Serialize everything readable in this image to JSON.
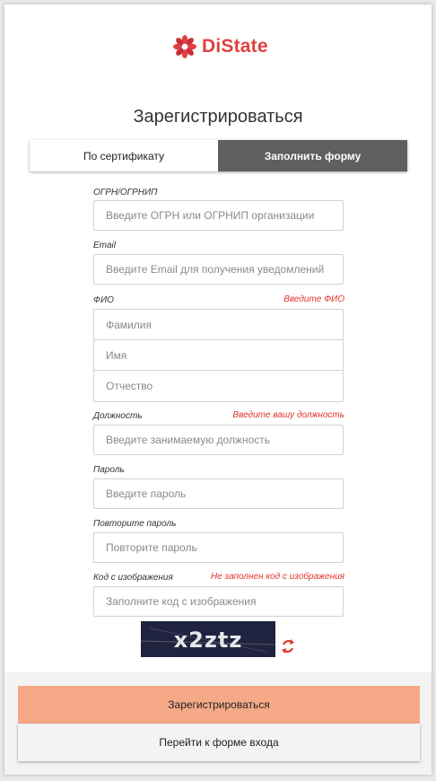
{
  "logo": {
    "text": "DiState",
    "icon": "flower-logo-icon",
    "color": "#e2403f"
  },
  "title": "Зарегистрироваться",
  "tabs": [
    {
      "label": "По сертификату",
      "active": false
    },
    {
      "label": "Заполнить форму",
      "active": true
    }
  ],
  "form": {
    "ogrn": {
      "label": "ОГРН/ОГРНИП",
      "placeholder": "Введите ОГРН или ОГРНИП организации",
      "value": ""
    },
    "email": {
      "label": "Email",
      "placeholder": "Введите Email для получения уведомлений",
      "value": ""
    },
    "fio": {
      "label": "ФИО",
      "error": "Введите ФИО",
      "last_name_placeholder": "Фамилия",
      "first_name_placeholder": "Имя",
      "middle_name_placeholder": "Отчество"
    },
    "position": {
      "label": "Должность",
      "error": "Введите вашу должность",
      "placeholder": "Введите занимаемую должность"
    },
    "password": {
      "label": "Пароль",
      "placeholder": "Введите пароль"
    },
    "password_repeat": {
      "label": "Повторите пароль",
      "placeholder": "Повторите пароль"
    },
    "captcha": {
      "label": "Код с изображения",
      "error": "Не заполнен код с изображения",
      "placeholder": "Заполните код с изображения",
      "image_text": "x2ztz",
      "refresh_icon": "refresh-icon"
    }
  },
  "buttons": {
    "register": "Зарегистрироваться",
    "to_login": "Перейти к форме входа"
  },
  "colors": {
    "accent": "#f5a987",
    "error": "#e0342b",
    "active_tab": "#5f5f5f"
  }
}
